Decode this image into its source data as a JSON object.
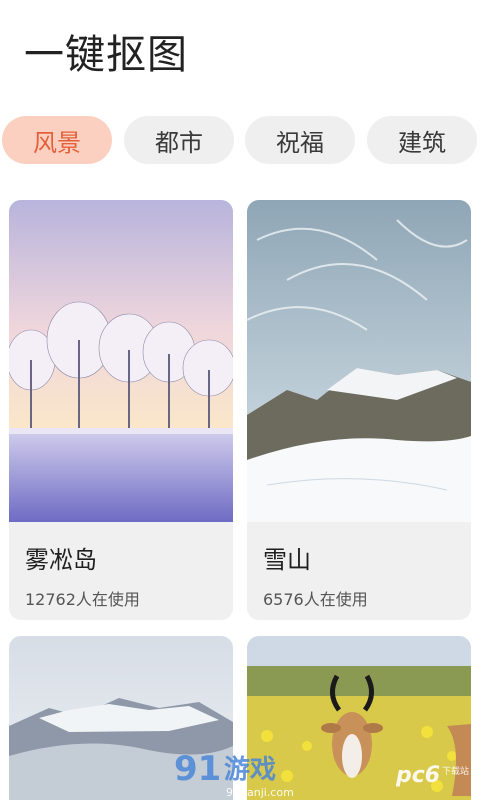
{
  "header": {
    "title": "一键抠图"
  },
  "tabs": [
    {
      "label": "风景",
      "active": true
    },
    {
      "label": "都市",
      "active": false
    },
    {
      "label": "祝福",
      "active": false
    },
    {
      "label": "建筑",
      "active": false
    }
  ],
  "cards": [
    {
      "name": "雾凇岛",
      "usage": "12762人在使用"
    },
    {
      "name": "雪山",
      "usage": "6576人在使用"
    }
  ],
  "watermarks": {
    "left": "91游戏",
    "left_sub": "91danji.com",
    "right": "pc6",
    "right_sub": "下载站"
  },
  "colors": {
    "accent_bg": "#fbd0c0",
    "accent_text": "#e4603a",
    "tab_bg": "#efefef"
  }
}
